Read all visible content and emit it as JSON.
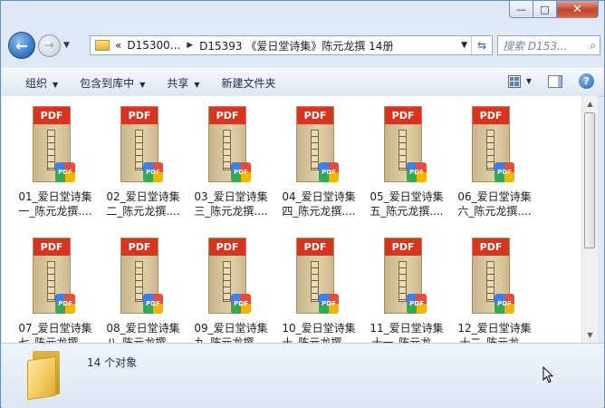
{
  "window": {
    "controls": {
      "minimize": "—",
      "maximize": "□",
      "close": "✕"
    }
  },
  "nav": {
    "back_icon": "back-arrow",
    "forward_icon": "forward-arrow",
    "breadcrumb_prefix": "«",
    "breadcrumb": [
      "D15300...",
      "D15393 《爱日堂诗集》陈元龙撰 14册"
    ],
    "search_placeholder": "搜索 D153..."
  },
  "toolbar": {
    "organize": "组织",
    "include_library": "包含到库中",
    "share": "共享",
    "new_folder": "新建文件夹"
  },
  "files": [
    {
      "line1": "01_爱日堂诗集",
      "line2": "一_陈元龙撰...."
    },
    {
      "line1": "02_爱日堂诗集",
      "line2": "二_陈元龙撰...."
    },
    {
      "line1": "03_爱日堂诗集",
      "line2": "三_陈元龙撰...."
    },
    {
      "line1": "04_爱日堂诗集",
      "line2": "四_陈元龙撰...."
    },
    {
      "line1": "05_爱日堂诗集",
      "line2": "五_陈元龙撰...."
    },
    {
      "line1": "06_爱日堂诗集",
      "line2": "六_陈元龙撰...."
    },
    {
      "line1": "07_爱日堂诗集",
      "line2": "七_陈元龙撰...."
    },
    {
      "line1": "08_爱日堂诗集",
      "line2": "八_陈元龙撰...."
    },
    {
      "line1": "09_爱日堂诗集",
      "line2": "九_陈元龙撰...."
    },
    {
      "line1": "10_爱日堂诗集",
      "line2": "十_陈元龙撰...."
    },
    {
      "line1": "11_爱日堂诗集",
      "line2": "十一_陈元龙..."
    },
    {
      "line1": "12_爱日堂诗集",
      "line2": "十二_陈元龙..."
    }
  ],
  "file_icon_label": "PDF",
  "details": {
    "count_text": "14 个对象"
  },
  "colors": {
    "pdf_label": "#d9341f",
    "window_frame": "#dfe9f5"
  }
}
